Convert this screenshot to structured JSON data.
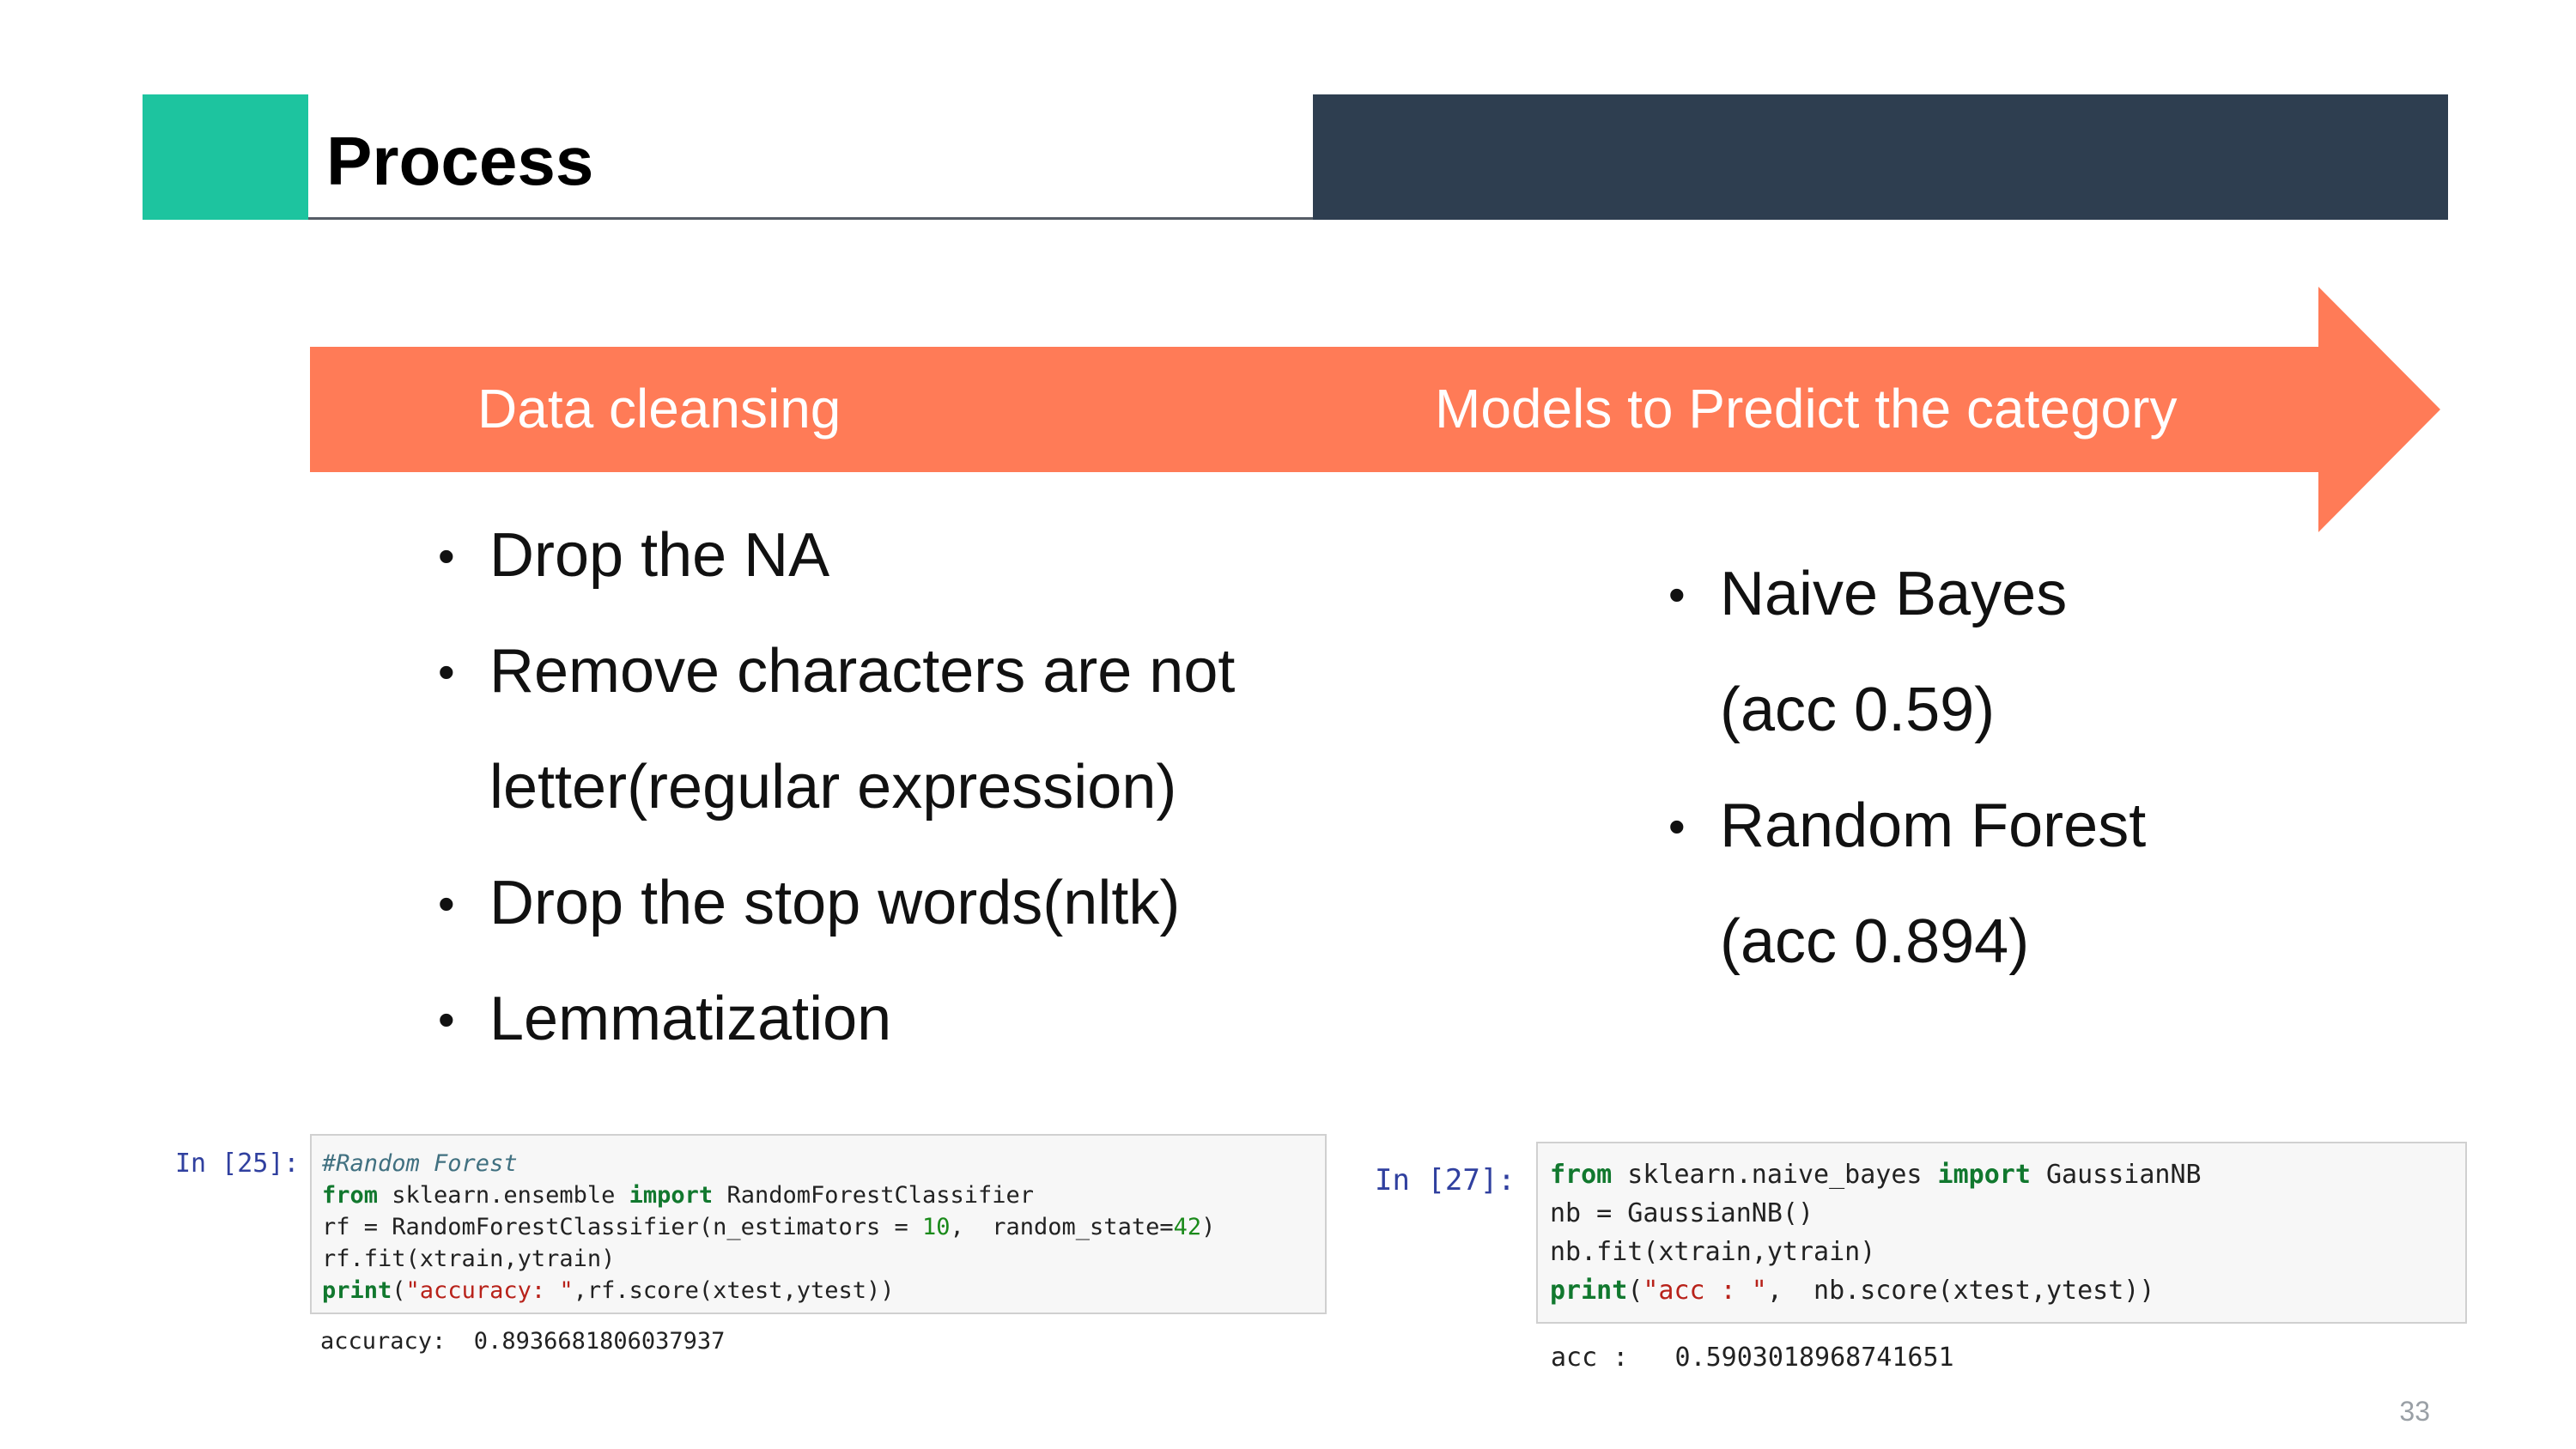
{
  "slide": {
    "title": "Process",
    "page_number": "33",
    "colors": {
      "accent": "#1dc49f",
      "dark_bar": "#2e3e50",
      "arrow": "#ff7b57"
    }
  },
  "arrow": {
    "left_label": "Data cleansing",
    "right_label": "Models to Predict the category"
  },
  "left_bullets": [
    "Drop the NA",
    "Remove characters are not",
    "letter(regular expression)",
    "Drop the stop words(nltk)",
    "Lemmatization"
  ],
  "right_bullets": [
    "Naive Bayes",
    "(acc 0.59)",
    "Random Forest",
    "(acc 0.894)"
  ],
  "code_left": {
    "prompt": "In  [25]:",
    "comment": "#Random Forest",
    "kw_from": "from",
    "module": " sklearn.ensemble ",
    "kw_import": "import",
    "cls": " RandomForestClassifier",
    "line3a": "rf = RandomForestClassifier(n_estimators = ",
    "n_est": "10",
    "line3b": ",  random_state=",
    "seed": "42",
    "line3c": ")",
    "line4": "rf.fit(xtrain,ytrain)",
    "print_kw": "print",
    "print_open": "(",
    "print_str": "\"accuracy: \"",
    "print_rest": ",rf.score(xtest,ytest))",
    "output": "accuracy:  0.8936681806037937"
  },
  "code_right": {
    "prompt": "In  [27]:",
    "kw_from": "from",
    "module": " sklearn.naive_bayes ",
    "kw_import": "import",
    "cls": " GaussianNB",
    "line2": "nb = GaussianNB()",
    "line3": "nb.fit(xtrain,ytrain)",
    "print_kw": "print",
    "print_open": "(",
    "print_str": "\"acc : \"",
    "print_rest": ",  nb.score(xtest,ytest))",
    "output": "acc :   0.5903018968741651"
  }
}
